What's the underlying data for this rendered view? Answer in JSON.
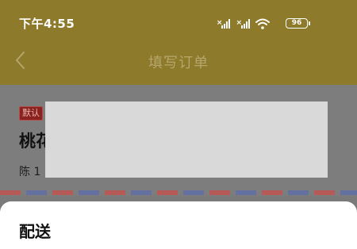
{
  "status_bar": {
    "time": "下午4:55",
    "battery_level": "96",
    "icons": [
      "signal-icon",
      "signal-icon",
      "wifi-icon",
      "battery-icon"
    ]
  },
  "nav": {
    "title": "填写订单",
    "back_icon": "chevron-left-icon"
  },
  "address": {
    "badge": "默认",
    "line": "桃花",
    "contact": "陈 1"
  },
  "sheet": {
    "title": "配送"
  },
  "colors": {
    "header": "#8d7a2a",
    "overlay": "#7a7a7a",
    "badge": "#8a2320",
    "stripe_red": "#b55a57",
    "stripe_blue": "#6470a0"
  }
}
